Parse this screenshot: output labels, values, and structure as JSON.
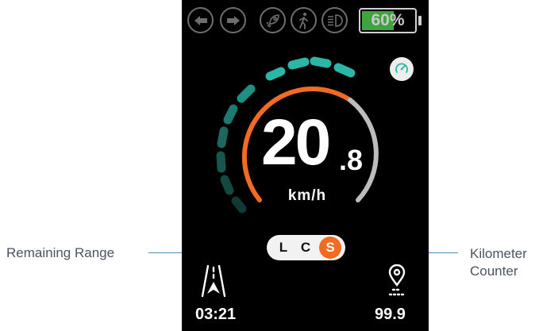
{
  "annotations": {
    "left_label": "Remaining Range",
    "right_label_line1": "Kilometer",
    "right_label_line2": "Counter"
  },
  "topbar": {
    "icons": [
      "turn-left-icon",
      "turn-right-icon",
      "rocket-icon",
      "walk-mode-icon",
      "headlight-icon"
    ],
    "battery_text": "60%",
    "battery_level": 0.6
  },
  "cruise_icon": "cruise-control-icon",
  "speedometer": {
    "speed_integer": "20",
    "speed_decimal": ".8",
    "unit": "km/h",
    "speed_fraction": 0.75
  },
  "modes": {
    "items": [
      "L",
      "C",
      "S"
    ],
    "active": "S"
  },
  "remaining_range": {
    "icon": "road-icon",
    "value": "03:21"
  },
  "odometer": {
    "icon": "location-pin-icon",
    "value": "99.9"
  },
  "colors": {
    "screen_bg": "#000000",
    "speed_arc": "#f26b21",
    "teal_segments": "#2bb7a8",
    "battery_green": "#3ea53e",
    "annotation_line": "#5b86c4",
    "annotation_text": "#4a5562"
  }
}
